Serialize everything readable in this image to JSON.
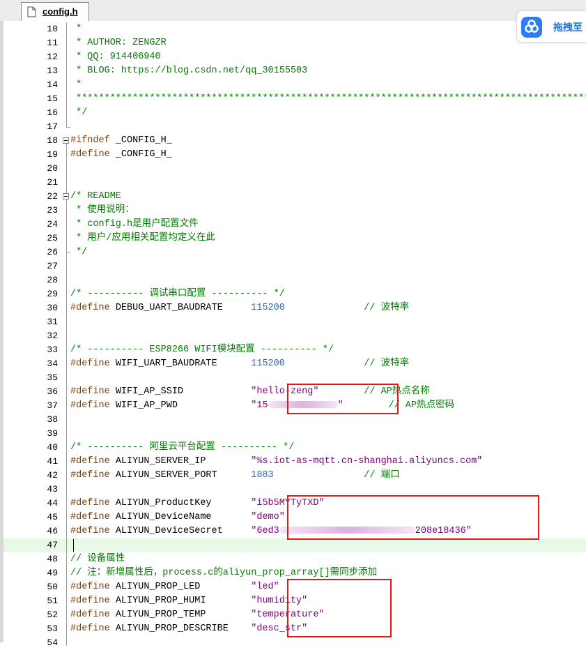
{
  "tab": {
    "filename": "config.h",
    "icon": "file-icon"
  },
  "baidu_button": {
    "label": "拖拽至",
    "icon": "cloud-drop-icon",
    "color": "#2e7cf6"
  },
  "colors": {
    "comment": "#008000",
    "preprocessor": "#804000",
    "number": "#3366aa",
    "string": "#800080",
    "highlight_box": "#e01818",
    "current_line": "#e8f9e8"
  },
  "lines": [
    {
      "n": "10",
      "segs": [
        {
          "t": " *",
          "c": "comment"
        }
      ]
    },
    {
      "n": "11",
      "segs": [
        {
          "t": " * AUTHOR: ZENGZR",
          "c": "comment"
        }
      ]
    },
    {
      "n": "12",
      "segs": [
        {
          "t": " * QQ: 914406940",
          "c": "comment"
        }
      ]
    },
    {
      "n": "13",
      "segs": [
        {
          "t": " * BLOG: https://blog.csdn.net/qq_30155503",
          "c": "comment"
        }
      ]
    },
    {
      "n": "14",
      "segs": [
        {
          "t": " *",
          "c": "comment"
        }
      ]
    },
    {
      "n": "15",
      "segs": [
        {
          "t": " *********************************************************************************************",
          "c": "comment"
        }
      ]
    },
    {
      "n": "16",
      "segs": [
        {
          "t": " */",
          "c": "comment"
        }
      ]
    },
    {
      "n": "17",
      "segs": []
    },
    {
      "n": "18",
      "segs": [
        {
          "t": "#ifndef ",
          "c": "pre"
        },
        {
          "t": "_CONFIG_H_",
          "c": "plain"
        }
      ]
    },
    {
      "n": "19",
      "segs": [
        {
          "t": "#define ",
          "c": "pre"
        },
        {
          "t": "_CONFIG_H_",
          "c": "plain"
        }
      ]
    },
    {
      "n": "20",
      "segs": []
    },
    {
      "n": "21",
      "segs": []
    },
    {
      "n": "22",
      "segs": [
        {
          "t": "/* README",
          "c": "comment"
        }
      ]
    },
    {
      "n": "23",
      "segs": [
        {
          "t": " * 使用说明：",
          "c": "comment"
        }
      ]
    },
    {
      "n": "24",
      "segs": [
        {
          "t": " * config.h是用户配置文件",
          "c": "comment"
        }
      ]
    },
    {
      "n": "25",
      "segs": [
        {
          "t": " * 用户/应用相关配置均定义在此",
          "c": "comment"
        }
      ]
    },
    {
      "n": "26",
      "segs": [
        {
          "t": " */",
          "c": "comment"
        }
      ]
    },
    {
      "n": "27",
      "segs": []
    },
    {
      "n": "28",
      "segs": []
    },
    {
      "n": "29",
      "segs": [
        {
          "t": "/* ---------- 调试串口配置 ---------- */",
          "c": "comment"
        }
      ]
    },
    {
      "n": "30",
      "segs": [
        {
          "t": "#define ",
          "c": "pre"
        },
        {
          "t": "DEBUG_UART_BAUDRATE     ",
          "c": "plain"
        },
        {
          "t": "115200",
          "c": "number"
        },
        {
          "t": "              ",
          "c": "plain"
        },
        {
          "t": "// 波特率",
          "c": "comment"
        }
      ]
    },
    {
      "n": "31",
      "segs": []
    },
    {
      "n": "32",
      "segs": []
    },
    {
      "n": "33",
      "segs": [
        {
          "t": "/* ---------- ESP8266 WIFI模块配置 ---------- */",
          "c": "comment"
        }
      ]
    },
    {
      "n": "34",
      "segs": [
        {
          "t": "#define ",
          "c": "pre"
        },
        {
          "t": "WIFI_UART_BAUDRATE      ",
          "c": "plain"
        },
        {
          "t": "115200",
          "c": "number"
        },
        {
          "t": "              ",
          "c": "plain"
        },
        {
          "t": "// 波特率",
          "c": "comment"
        }
      ]
    },
    {
      "n": "35",
      "segs": []
    },
    {
      "n": "36",
      "segs": [
        {
          "t": "#define ",
          "c": "pre"
        },
        {
          "t": "WIFI_AP_SSID            ",
          "c": "plain"
        },
        {
          "t": "\"hello-zeng\"",
          "c": "string"
        },
        {
          "t": "        ",
          "c": "plain"
        },
        {
          "t": "// AP热点名称",
          "c": "comment"
        }
      ]
    },
    {
      "n": "37",
      "segs": [
        {
          "t": "#define ",
          "c": "pre"
        },
        {
          "t": "WIFI_AP_PWD             ",
          "c": "plain"
        },
        {
          "t": "\"15",
          "c": "string"
        },
        {
          "t": "",
          "c": "blur",
          "w": 100
        },
        {
          "t": "\"",
          "c": "string"
        },
        {
          "t": "        ",
          "c": "plain"
        },
        {
          "t": "// AP热点密码",
          "c": "comment"
        }
      ]
    },
    {
      "n": "38",
      "segs": []
    },
    {
      "n": "39",
      "segs": []
    },
    {
      "n": "40",
      "segs": [
        {
          "t": "/* ---------- 阿里云平台配置 ---------- */",
          "c": "comment"
        }
      ]
    },
    {
      "n": "41",
      "segs": [
        {
          "t": "#define ",
          "c": "pre"
        },
        {
          "t": "ALIYUN_SERVER_IP        ",
          "c": "plain"
        },
        {
          "t": "\"%s.iot-as-mqtt.cn-shanghai.aliyuncs.com\"",
          "c": "string"
        }
      ]
    },
    {
      "n": "42",
      "segs": [
        {
          "t": "#define ",
          "c": "pre"
        },
        {
          "t": "ALIYUN_SERVER_PORT      ",
          "c": "plain"
        },
        {
          "t": "1883",
          "c": "number"
        },
        {
          "t": "                ",
          "c": "plain"
        },
        {
          "t": "// 端口",
          "c": "comment"
        }
      ]
    },
    {
      "n": "43",
      "segs": []
    },
    {
      "n": "44",
      "segs": [
        {
          "t": "#define ",
          "c": "pre"
        },
        {
          "t": "ALIYUN_ProductKey       ",
          "c": "plain"
        },
        {
          "t": "\"i5b5MYTyTXD\"",
          "c": "string"
        }
      ]
    },
    {
      "n": "45",
      "segs": [
        {
          "t": "#define ",
          "c": "pre"
        },
        {
          "t": "ALIYUN_DeviceName       ",
          "c": "plain"
        },
        {
          "t": "\"demo\"",
          "c": "string"
        }
      ]
    },
    {
      "n": "46",
      "segs": [
        {
          "t": "#define ",
          "c": "pre"
        },
        {
          "t": "ALIYUN_DeviceSecret     ",
          "c": "plain"
        },
        {
          "t": "\"6ed3",
          "c": "string"
        },
        {
          "t": "",
          "c": "blur",
          "w": 195
        },
        {
          "t": "208e18436\"",
          "c": "string"
        }
      ]
    },
    {
      "n": "47",
      "segs": [],
      "current": true
    },
    {
      "n": "48",
      "segs": [
        {
          "t": "// 设备属性",
          "c": "comment"
        }
      ]
    },
    {
      "n": "49",
      "segs": [
        {
          "t": "// 注：新增属性后，process.c的aliyun_prop_array[]需同步添加",
          "c": "comment"
        }
      ]
    },
    {
      "n": "50",
      "segs": [
        {
          "t": "#define ",
          "c": "pre"
        },
        {
          "t": "ALIYUN_PROP_LED         ",
          "c": "plain"
        },
        {
          "t": "\"led\"",
          "c": "string"
        }
      ]
    },
    {
      "n": "51",
      "segs": [
        {
          "t": "#define ",
          "c": "pre"
        },
        {
          "t": "ALIYUN_PROP_HUMI        ",
          "c": "plain"
        },
        {
          "t": "\"humidity\"",
          "c": "string"
        }
      ]
    },
    {
      "n": "52",
      "segs": [
        {
          "t": "#define ",
          "c": "pre"
        },
        {
          "t": "ALIYUN_PROP_TEMP        ",
          "c": "plain"
        },
        {
          "t": "\"temperature\"",
          "c": "string"
        }
      ]
    },
    {
      "n": "53",
      "segs": [
        {
          "t": "#define ",
          "c": "pre"
        },
        {
          "t": "ALIYUN_PROP_DESCRIBE    ",
          "c": "plain"
        },
        {
          "t": "\"desc_str\"",
          "c": "string"
        }
      ]
    },
    {
      "n": "54",
      "segs": []
    }
  ]
}
